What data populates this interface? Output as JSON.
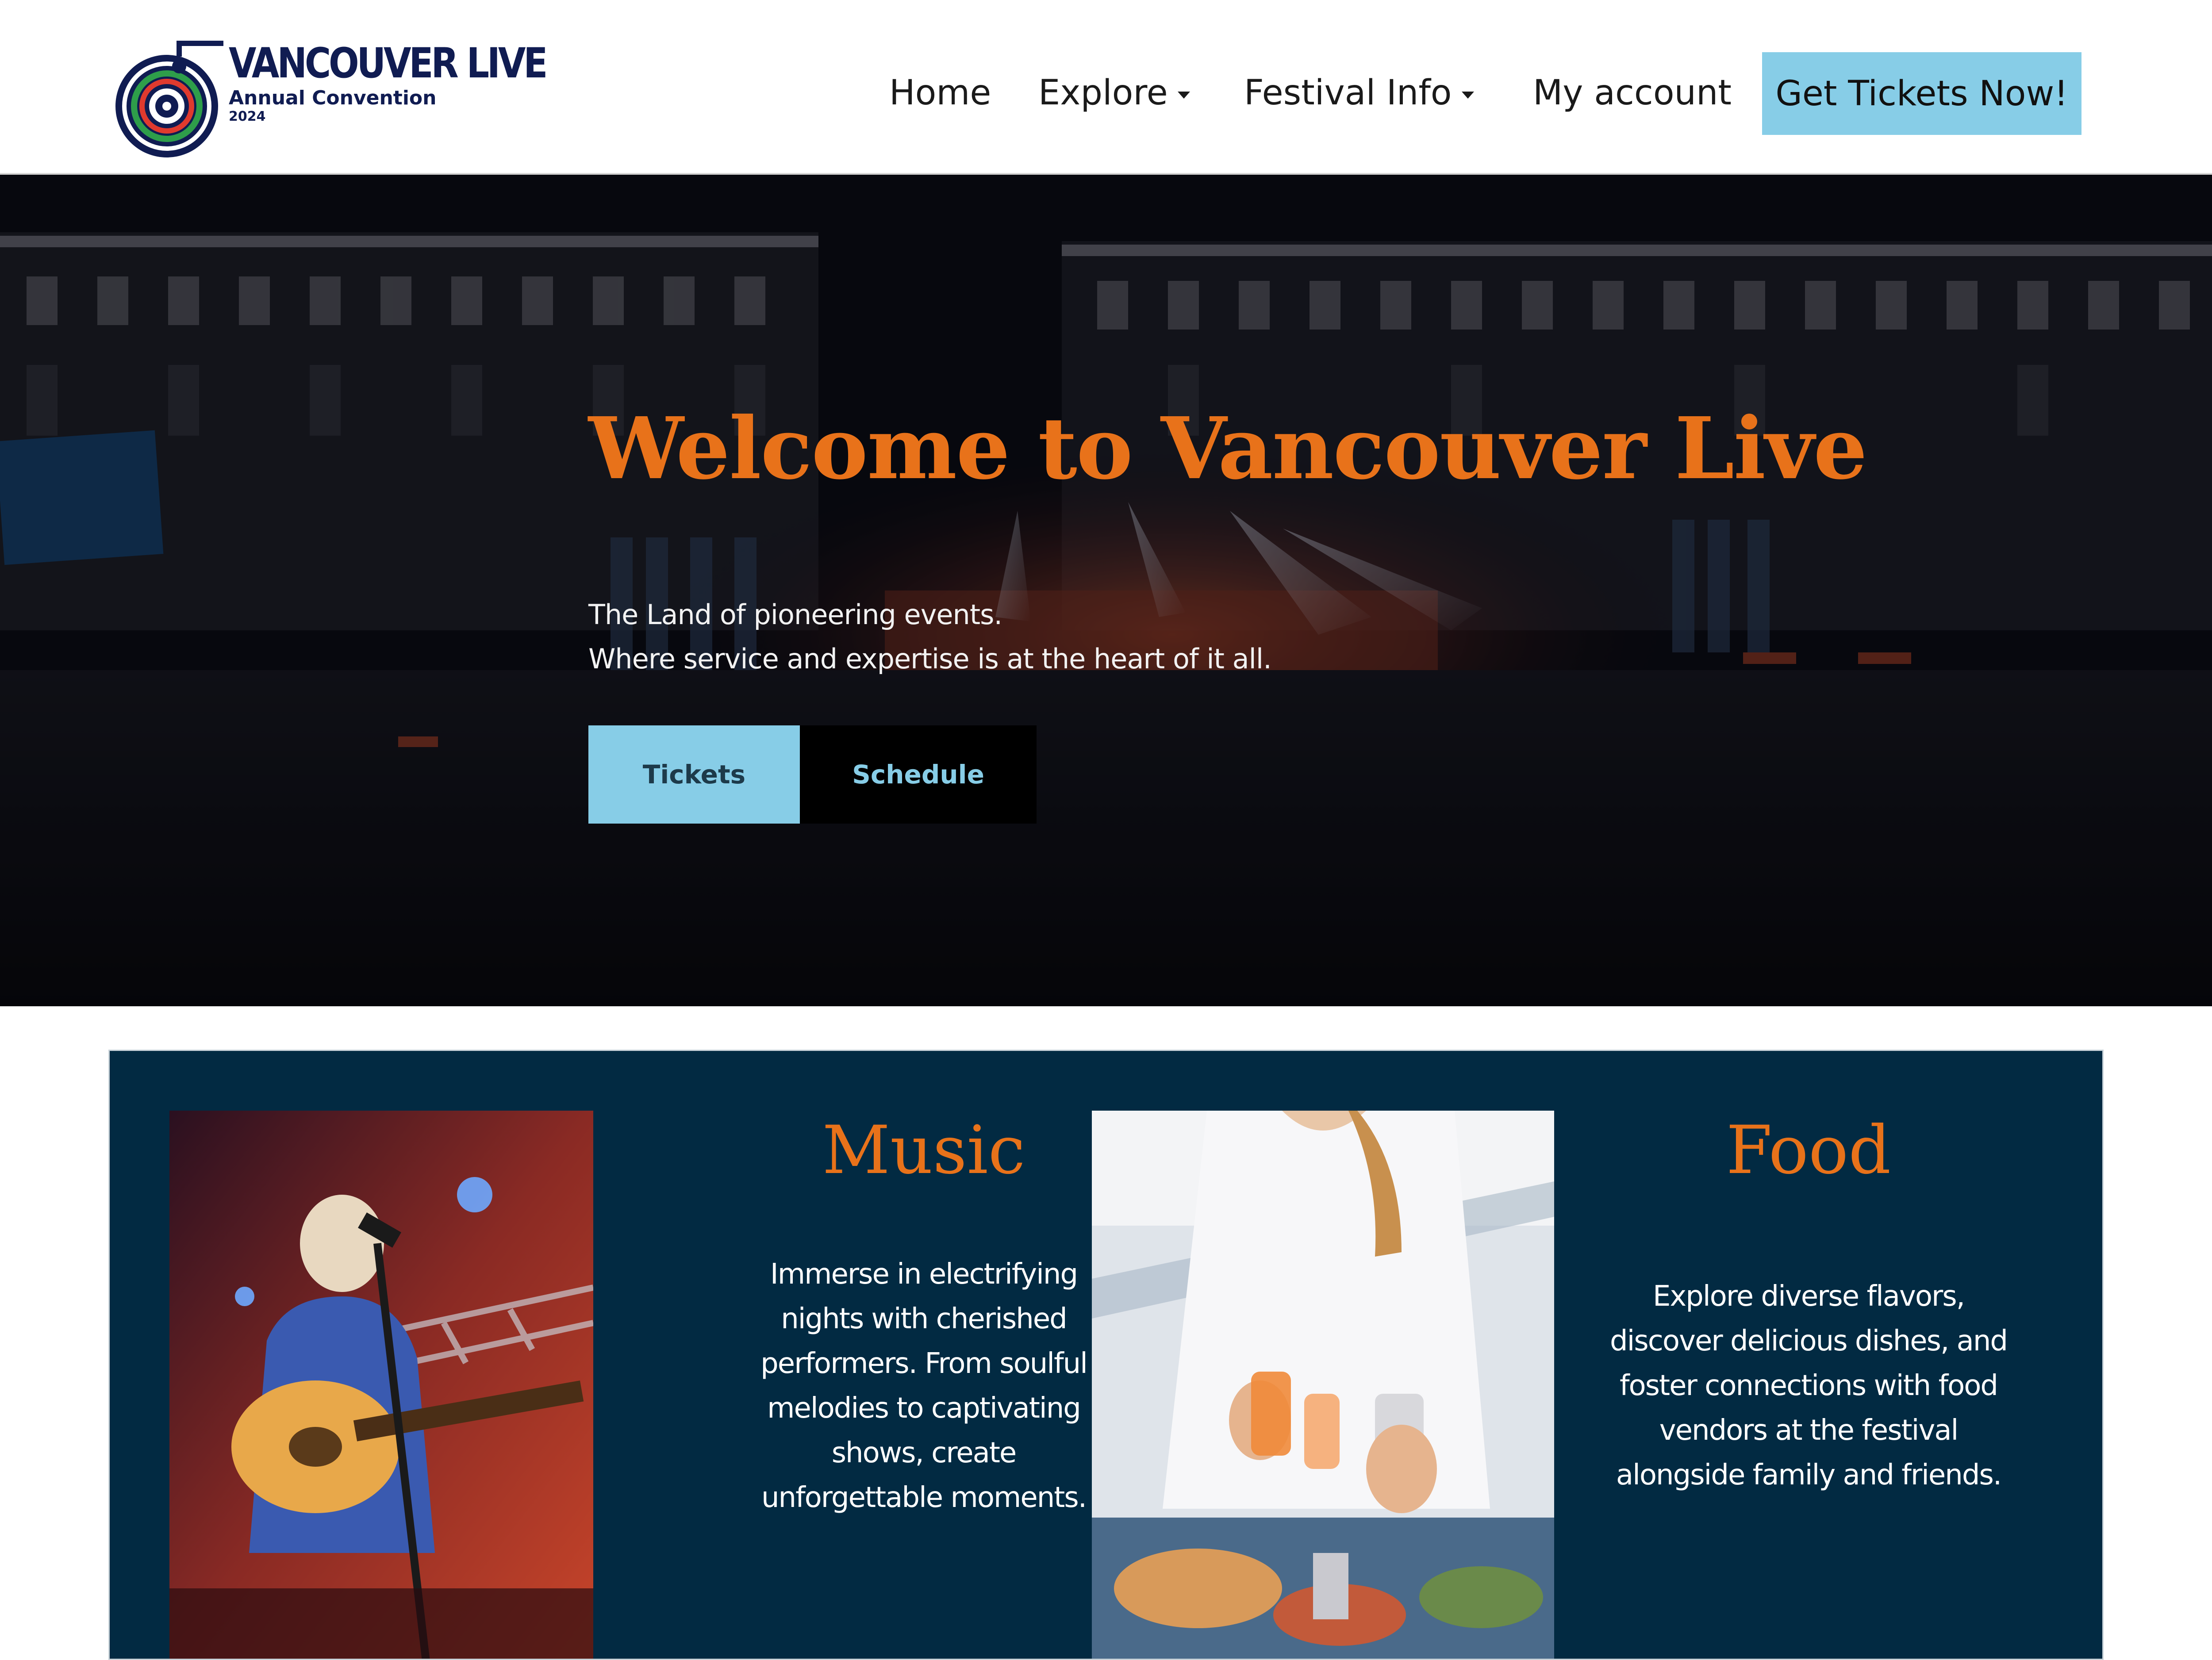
{
  "header": {
    "logo": {
      "name": "VANCOUVER LIVE",
      "subtitle": "Annual Convention",
      "year": "2024"
    },
    "nav": [
      {
        "label": "Home",
        "has_dropdown": false
      },
      {
        "label": "Explore",
        "has_dropdown": true
      },
      {
        "label": "Festival Info",
        "has_dropdown": true
      },
      {
        "label": "My account",
        "has_dropdown": false
      }
    ],
    "cta_label": "Get Tickets Now!"
  },
  "hero": {
    "title": "Welcome to Vancouver Live",
    "lines": [
      "The Land of pioneering events.",
      "Where service and expertise is at the heart of it all."
    ],
    "buttons": {
      "tickets": "Tickets",
      "schedule": "Schedule"
    }
  },
  "features": [
    {
      "title": "Music",
      "lines": [
        "Immerse in electrifying",
        "nights with cherished",
        "performers. From soulful",
        "melodies to captivating",
        "shows, create",
        "unforgettable moments."
      ]
    },
    {
      "title": "Food",
      "lines": [
        "Explore diverse flavors,",
        "discover delicious dishes, and",
        "foster connections with food",
        "vendors at the festival",
        "alongside family and friends."
      ]
    }
  ],
  "colors": {
    "accent_orange": "#e8721a",
    "button_blue": "#87cde7",
    "navy": "#022a42",
    "logo_navy": "#101c52"
  }
}
